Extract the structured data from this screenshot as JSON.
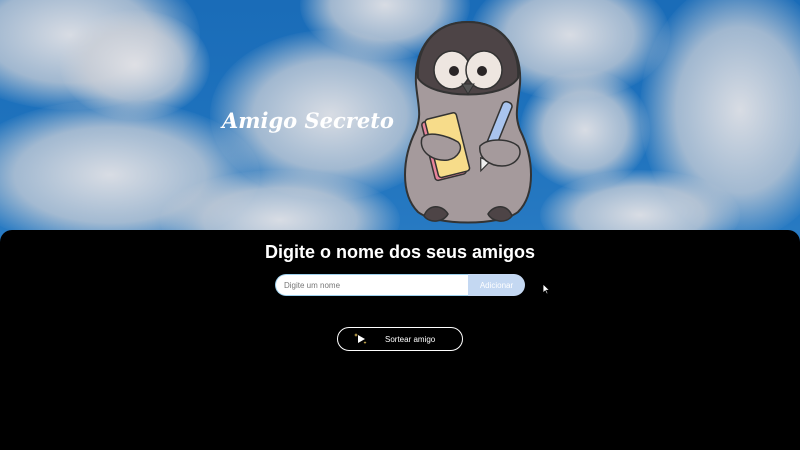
{
  "header": {
    "title": "Amigo Secreto",
    "illustration": "penguin-with-notebook-and-pen"
  },
  "main": {
    "heading": "Digite o nome dos seus amigos",
    "name_input": {
      "placeholder": "Digite um nome",
      "value": ""
    },
    "add_button_label": "Adicionar",
    "draw_button": {
      "label": "Sortear amigo",
      "icon": "play-sparkle-icon"
    }
  },
  "colors": {
    "sky": "#1a6cb8",
    "panel": "#000000",
    "input_border": "#9ed1ee",
    "add_button": "#c4d8f2"
  }
}
